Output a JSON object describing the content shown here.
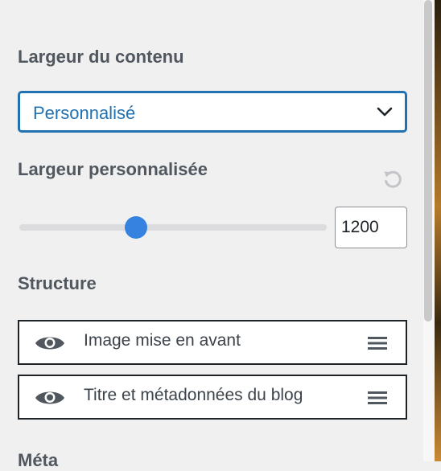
{
  "content_width": {
    "label": "Largeur du contenu",
    "selected": "Personnalisé"
  },
  "custom_width": {
    "label": "Largeur personnalisée",
    "value": "1200",
    "slider_fraction": 0.38
  },
  "structure": {
    "label": "Structure",
    "items": [
      {
        "label": "Image mise en avant",
        "icon": "eye-icon"
      },
      {
        "label": "Titre et métadonnées du blog",
        "icon": "eye-icon"
      }
    ]
  },
  "next_section": {
    "label": "Méta"
  },
  "colors": {
    "accent": "#2271b1",
    "slider_thumb": "#3582e0"
  }
}
